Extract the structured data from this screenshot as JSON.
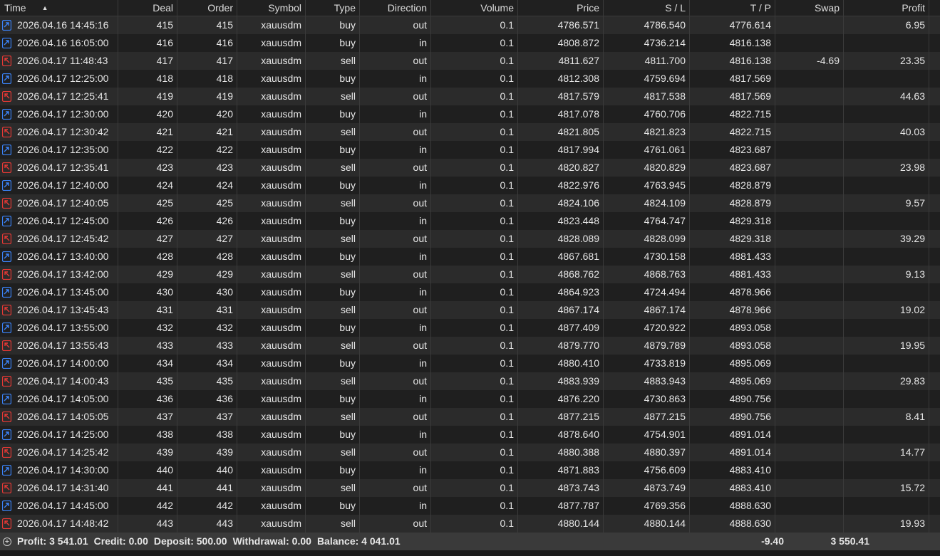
{
  "columns": {
    "time": "Time",
    "deal": "Deal",
    "order": "Order",
    "symbol": "Symbol",
    "type": "Type",
    "direction": "Direction",
    "volume": "Volume",
    "price": "Price",
    "sl": "S / L",
    "tp": "T / P",
    "swap": "Swap",
    "profit": "Profit"
  },
  "colors": {
    "buy_icon": "#3b82f6",
    "sell_icon": "#e53935"
  },
  "rows": [
    {
      "time": "2026.04.16 14:45:16",
      "deal": "415",
      "order": "415",
      "symbol": "xauusdm",
      "type": "buy",
      "direction": "out",
      "volume": "0.1",
      "price": "4786.571",
      "sl": "4786.540",
      "tp": "4776.614",
      "swap": "",
      "profit": "6.95",
      "icon": "buy-out-icon"
    },
    {
      "time": "2026.04.16 16:05:00",
      "deal": "416",
      "order": "416",
      "symbol": "xauusdm",
      "type": "buy",
      "direction": "in",
      "volume": "0.1",
      "price": "4808.872",
      "sl": "4736.214",
      "tp": "4816.138",
      "swap": "",
      "profit": "",
      "icon": "buy-in-icon"
    },
    {
      "time": "2026.04.17 11:48:43",
      "deal": "417",
      "order": "417",
      "symbol": "xauusdm",
      "type": "sell",
      "direction": "out",
      "volume": "0.1",
      "price": "4811.627",
      "sl": "4811.700",
      "tp": "4816.138",
      "swap": "-4.69",
      "profit": "23.35",
      "icon": "sell-out-icon"
    },
    {
      "time": "2026.04.17 12:25:00",
      "deal": "418",
      "order": "418",
      "symbol": "xauusdm",
      "type": "buy",
      "direction": "in",
      "volume": "0.1",
      "price": "4812.308",
      "sl": "4759.694",
      "tp": "4817.569",
      "swap": "",
      "profit": "",
      "icon": "buy-in-icon"
    },
    {
      "time": "2026.04.17 12:25:41",
      "deal": "419",
      "order": "419",
      "symbol": "xauusdm",
      "type": "sell",
      "direction": "out",
      "volume": "0.1",
      "price": "4817.579",
      "sl": "4817.538",
      "tp": "4817.569",
      "swap": "",
      "profit": "44.63",
      "icon": "sell-out-icon"
    },
    {
      "time": "2026.04.17 12:30:00",
      "deal": "420",
      "order": "420",
      "symbol": "xauusdm",
      "type": "buy",
      "direction": "in",
      "volume": "0.1",
      "price": "4817.078",
      "sl": "4760.706",
      "tp": "4822.715",
      "swap": "",
      "profit": "",
      "icon": "buy-in-icon"
    },
    {
      "time": "2026.04.17 12:30:42",
      "deal": "421",
      "order": "421",
      "symbol": "xauusdm",
      "type": "sell",
      "direction": "out",
      "volume": "0.1",
      "price": "4821.805",
      "sl": "4821.823",
      "tp": "4822.715",
      "swap": "",
      "profit": "40.03",
      "icon": "sell-out-icon"
    },
    {
      "time": "2026.04.17 12:35:00",
      "deal": "422",
      "order": "422",
      "symbol": "xauusdm",
      "type": "buy",
      "direction": "in",
      "volume": "0.1",
      "price": "4817.994",
      "sl": "4761.061",
      "tp": "4823.687",
      "swap": "",
      "profit": "",
      "icon": "buy-in-icon"
    },
    {
      "time": "2026.04.17 12:35:41",
      "deal": "423",
      "order": "423",
      "symbol": "xauusdm",
      "type": "sell",
      "direction": "out",
      "volume": "0.1",
      "price": "4820.827",
      "sl": "4820.829",
      "tp": "4823.687",
      "swap": "",
      "profit": "23.98",
      "icon": "sell-out-icon"
    },
    {
      "time": "2026.04.17 12:40:00",
      "deal": "424",
      "order": "424",
      "symbol": "xauusdm",
      "type": "buy",
      "direction": "in",
      "volume": "0.1",
      "price": "4822.976",
      "sl": "4763.945",
      "tp": "4828.879",
      "swap": "",
      "profit": "",
      "icon": "buy-in-icon"
    },
    {
      "time": "2026.04.17 12:40:05",
      "deal": "425",
      "order": "425",
      "symbol": "xauusdm",
      "type": "sell",
      "direction": "out",
      "volume": "0.1",
      "price": "4824.106",
      "sl": "4824.109",
      "tp": "4828.879",
      "swap": "",
      "profit": "9.57",
      "icon": "sell-out-icon"
    },
    {
      "time": "2026.04.17 12:45:00",
      "deal": "426",
      "order": "426",
      "symbol": "xauusdm",
      "type": "buy",
      "direction": "in",
      "volume": "0.1",
      "price": "4823.448",
      "sl": "4764.747",
      "tp": "4829.318",
      "swap": "",
      "profit": "",
      "icon": "buy-in-icon"
    },
    {
      "time": "2026.04.17 12:45:42",
      "deal": "427",
      "order": "427",
      "symbol": "xauusdm",
      "type": "sell",
      "direction": "out",
      "volume": "0.1",
      "price": "4828.089",
      "sl": "4828.099",
      "tp": "4829.318",
      "swap": "",
      "profit": "39.29",
      "icon": "sell-out-icon"
    },
    {
      "time": "2026.04.17 13:40:00",
      "deal": "428",
      "order": "428",
      "symbol": "xauusdm",
      "type": "buy",
      "direction": "in",
      "volume": "0.1",
      "price": "4867.681",
      "sl": "4730.158",
      "tp": "4881.433",
      "swap": "",
      "profit": "",
      "icon": "buy-in-icon"
    },
    {
      "time": "2026.04.17 13:42:00",
      "deal": "429",
      "order": "429",
      "symbol": "xauusdm",
      "type": "sell",
      "direction": "out",
      "volume": "0.1",
      "price": "4868.762",
      "sl": "4868.763",
      "tp": "4881.433",
      "swap": "",
      "profit": "9.13",
      "icon": "sell-out-icon"
    },
    {
      "time": "2026.04.17 13:45:00",
      "deal": "430",
      "order": "430",
      "symbol": "xauusdm",
      "type": "buy",
      "direction": "in",
      "volume": "0.1",
      "price": "4864.923",
      "sl": "4724.494",
      "tp": "4878.966",
      "swap": "",
      "profit": "",
      "icon": "buy-in-icon"
    },
    {
      "time": "2026.04.17 13:45:43",
      "deal": "431",
      "order": "431",
      "symbol": "xauusdm",
      "type": "sell",
      "direction": "out",
      "volume": "0.1",
      "price": "4867.174",
      "sl": "4867.174",
      "tp": "4878.966",
      "swap": "",
      "profit": "19.02",
      "icon": "sell-out-icon"
    },
    {
      "time": "2026.04.17 13:55:00",
      "deal": "432",
      "order": "432",
      "symbol": "xauusdm",
      "type": "buy",
      "direction": "in",
      "volume": "0.1",
      "price": "4877.409",
      "sl": "4720.922",
      "tp": "4893.058",
      "swap": "",
      "profit": "",
      "icon": "buy-in-icon"
    },
    {
      "time": "2026.04.17 13:55:43",
      "deal": "433",
      "order": "433",
      "symbol": "xauusdm",
      "type": "sell",
      "direction": "out",
      "volume": "0.1",
      "price": "4879.770",
      "sl": "4879.789",
      "tp": "4893.058",
      "swap": "",
      "profit": "19.95",
      "icon": "sell-out-icon"
    },
    {
      "time": "2026.04.17 14:00:00",
      "deal": "434",
      "order": "434",
      "symbol": "xauusdm",
      "type": "buy",
      "direction": "in",
      "volume": "0.1",
      "price": "4880.410",
      "sl": "4733.819",
      "tp": "4895.069",
      "swap": "",
      "profit": "",
      "icon": "buy-in-icon"
    },
    {
      "time": "2026.04.17 14:00:43",
      "deal": "435",
      "order": "435",
      "symbol": "xauusdm",
      "type": "sell",
      "direction": "out",
      "volume": "0.1",
      "price": "4883.939",
      "sl": "4883.943",
      "tp": "4895.069",
      "swap": "",
      "profit": "29.83",
      "icon": "sell-out-icon"
    },
    {
      "time": "2026.04.17 14:05:00",
      "deal": "436",
      "order": "436",
      "symbol": "xauusdm",
      "type": "buy",
      "direction": "in",
      "volume": "0.1",
      "price": "4876.220",
      "sl": "4730.863",
      "tp": "4890.756",
      "swap": "",
      "profit": "",
      "icon": "buy-in-icon"
    },
    {
      "time": "2026.04.17 14:05:05",
      "deal": "437",
      "order": "437",
      "symbol": "xauusdm",
      "type": "sell",
      "direction": "out",
      "volume": "0.1",
      "price": "4877.215",
      "sl": "4877.215",
      "tp": "4890.756",
      "swap": "",
      "profit": "8.41",
      "icon": "sell-out-icon"
    },
    {
      "time": "2026.04.17 14:25:00",
      "deal": "438",
      "order": "438",
      "symbol": "xauusdm",
      "type": "buy",
      "direction": "in",
      "volume": "0.1",
      "price": "4878.640",
      "sl": "4754.901",
      "tp": "4891.014",
      "swap": "",
      "profit": "",
      "icon": "buy-in-icon"
    },
    {
      "time": "2026.04.17 14:25:42",
      "deal": "439",
      "order": "439",
      "symbol": "xauusdm",
      "type": "sell",
      "direction": "out",
      "volume": "0.1",
      "price": "4880.388",
      "sl": "4880.397",
      "tp": "4891.014",
      "swap": "",
      "profit": "14.77",
      "icon": "sell-out-icon"
    },
    {
      "time": "2026.04.17 14:30:00",
      "deal": "440",
      "order": "440",
      "symbol": "xauusdm",
      "type": "buy",
      "direction": "in",
      "volume": "0.1",
      "price": "4871.883",
      "sl": "4756.609",
      "tp": "4883.410",
      "swap": "",
      "profit": "",
      "icon": "buy-in-icon"
    },
    {
      "time": "2026.04.17 14:31:40",
      "deal": "441",
      "order": "441",
      "symbol": "xauusdm",
      "type": "sell",
      "direction": "out",
      "volume": "0.1",
      "price": "4873.743",
      "sl": "4873.749",
      "tp": "4883.410",
      "swap": "",
      "profit": "15.72",
      "icon": "sell-out-icon"
    },
    {
      "time": "2026.04.17 14:45:00",
      "deal": "442",
      "order": "442",
      "symbol": "xauusdm",
      "type": "buy",
      "direction": "in",
      "volume": "0.1",
      "price": "4877.787",
      "sl": "4769.356",
      "tp": "4888.630",
      "swap": "",
      "profit": "",
      "icon": "buy-in-icon"
    },
    {
      "time": "2026.04.17 14:48:42",
      "deal": "443",
      "order": "443",
      "symbol": "xauusdm",
      "type": "sell",
      "direction": "out",
      "volume": "0.1",
      "price": "4880.144",
      "sl": "4880.144",
      "tp": "4888.630",
      "swap": "",
      "profit": "19.93",
      "icon": "sell-out-icon"
    }
  ],
  "summary": {
    "icon": "plus-circle-icon",
    "profit": "Profit: 3 541.01",
    "credit": "Credit: 0.00",
    "deposit": "Deposit: 500.00",
    "withdrawal": "Withdrawal: 0.00",
    "balance": "Balance: 4 041.01",
    "swap_total": "-9.40",
    "profit_total": "3 550.41"
  }
}
